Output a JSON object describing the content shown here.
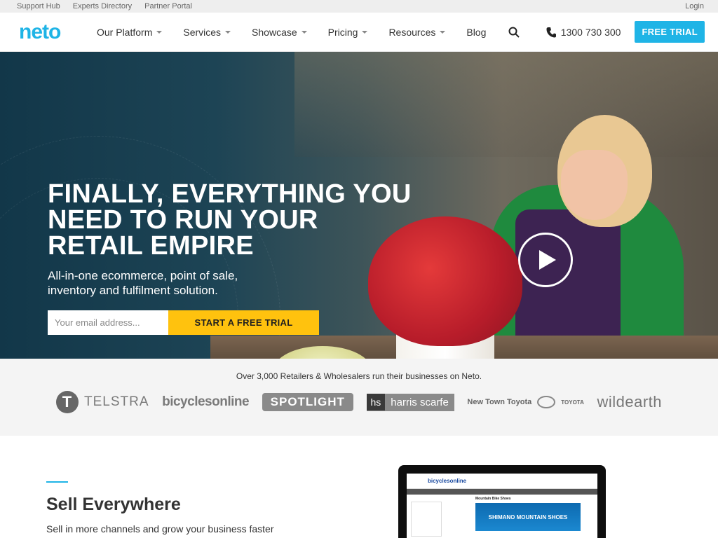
{
  "utility": {
    "links": [
      "Support Hub",
      "Experts Directory",
      "Partner Portal"
    ],
    "login": "Login"
  },
  "nav": {
    "logo": "neto",
    "items": [
      {
        "label": "Our Platform",
        "has_dropdown": true
      },
      {
        "label": "Services",
        "has_dropdown": true
      },
      {
        "label": "Showcase",
        "has_dropdown": true
      },
      {
        "label": "Pricing",
        "has_dropdown": true
      },
      {
        "label": "Resources",
        "has_dropdown": true
      },
      {
        "label": "Blog",
        "has_dropdown": false
      }
    ],
    "search_icon": "search-icon",
    "phone_icon": "phone-icon",
    "phone": "1300 730 300",
    "cta": "FREE TRIAL"
  },
  "hero": {
    "headline": "FINALLY, EVERYTHING YOU NEED TO RUN YOUR RETAIL EMPIRE",
    "subhead": "All-in-one ecommerce, point of sale, inventory and fulfilment solution.",
    "email_placeholder": "Your email address...",
    "cta": "START A FREE TRIAL",
    "play_icon": "play-icon"
  },
  "logos": {
    "title": "Over 3,000 Retailers & Wholesalers run their businesses on Neto.",
    "brands": {
      "telstra_mark": "T",
      "telstra": "TELSTRA",
      "bicycles": "bicyclesonline",
      "spotlight": "SPOTLIGHT",
      "harris_short": "hs",
      "harris": "harris scarfe",
      "toyota": "New Town Toyota",
      "toyota_brand": "TOYOTA",
      "wild": "wildearth"
    }
  },
  "section": {
    "title": "Sell Everywhere",
    "subtitle": "Sell in more channels and grow your business faster",
    "mockup": {
      "logo": "bicyclesonline",
      "page_title": "Mountain Bike Shoes",
      "banner": "SHIMANO MOUNTAIN SHOES"
    }
  },
  "colors": {
    "brand": "#1fb4e6",
    "cta_yellow": "#ffc20e"
  }
}
